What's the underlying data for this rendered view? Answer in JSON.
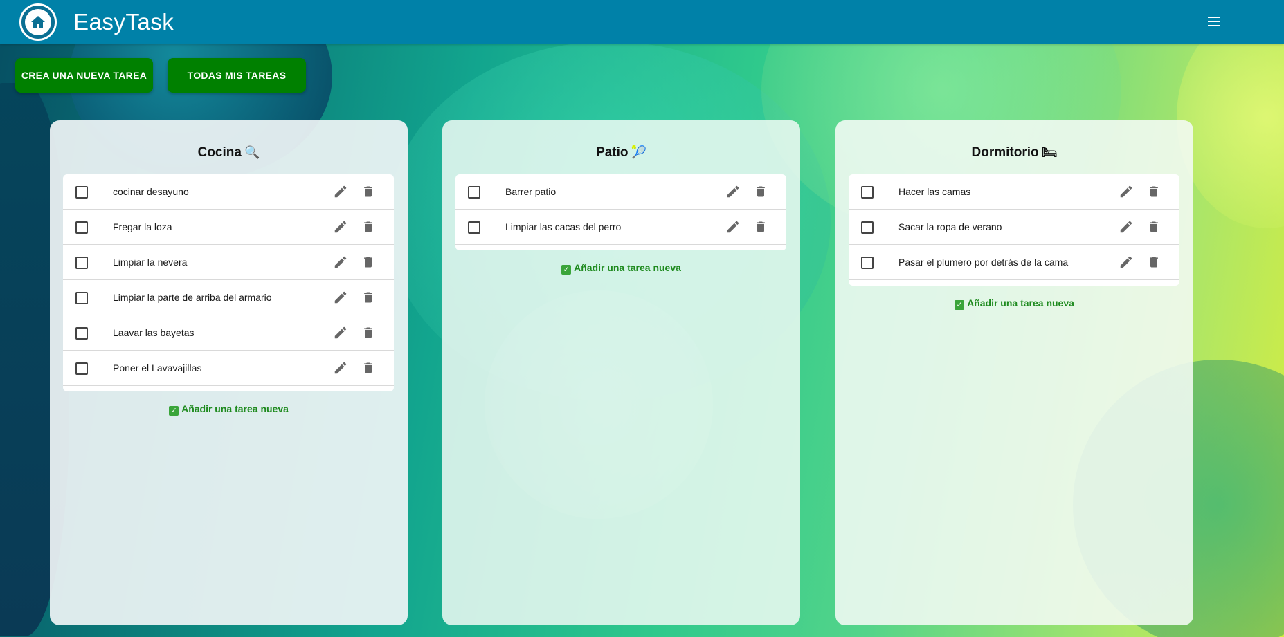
{
  "header": {
    "app_title": "EasyTask",
    "logo_icon": "house-icon",
    "menu_icon": "hamburger-menu-icon"
  },
  "actions": {
    "new_task_label": "CREA UNA NUEVA TAREA",
    "all_tasks_label": "TODAS MIS TAREAS"
  },
  "columns": [
    {
      "title": "Cocina",
      "emoji": "🔍",
      "tasks": [
        {
          "text": "cocinar desayuno",
          "done": false
        },
        {
          "text": "Fregar la loza",
          "done": false
        },
        {
          "text": "Limpiar la nevera",
          "done": false
        },
        {
          "text": "Limpiar la parte de arriba del armario",
          "done": false
        },
        {
          "text": "Laavar las bayetas",
          "done": false
        },
        {
          "text": "Poner el Lavavajillas",
          "done": false
        }
      ],
      "add_label": "Añadir una tarea nueva"
    },
    {
      "title": "Patio",
      "emoji": "🎾",
      "tasks": [
        {
          "text": "Barrer patio",
          "done": false
        },
        {
          "text": "Limpiar las cacas del perro",
          "done": false
        }
      ],
      "add_label": "Añadir una tarea nueva"
    },
    {
      "title": "Dormitorio",
      "emoji": "🛏",
      "tasks": [
        {
          "text": "Hacer las camas",
          "done": false
        },
        {
          "text": "Sacar la ropa de verano",
          "done": false
        },
        {
          "text": "Pasar el plumero por detrás de la cama",
          "done": false
        }
      ],
      "add_label": "Añadir una tarea nueva"
    }
  ],
  "colors": {
    "topbar": "#0081a8",
    "button": "#008000",
    "add_link": "#1e8a1e"
  }
}
